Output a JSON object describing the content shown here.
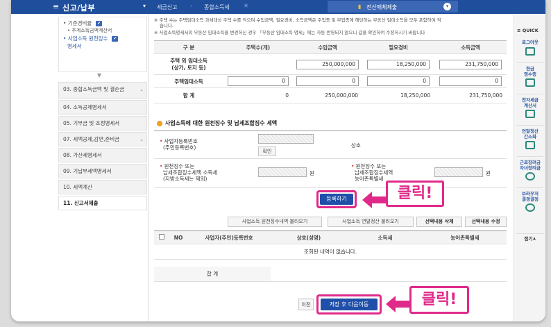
{
  "topbar": {
    "title": "신고/납부",
    "crumb1": "세금신고",
    "crumb2": "종합소득세",
    "esubmit": "전산매체제출"
  },
  "sidebar": {
    "sub": [
      {
        "label": "기준경비율"
      },
      {
        "label": "추계소득금액계산서"
      },
      {
        "label": "사업소득 원천징수"
      },
      {
        "label": "명세서"
      }
    ],
    "nav": [
      {
        "label": "03. 종합소득금액 및 결손금"
      },
      {
        "label": "04. 소득공제명세서"
      },
      {
        "label": "05. 기부금 및 조정명세서"
      },
      {
        "label": "07. 세액공제,감면,준비금"
      },
      {
        "label": "08. 가산세명세서"
      },
      {
        "label": "09. 기납부세액명세서"
      },
      {
        "label": "10. 세액계산"
      },
      {
        "label": "11. 신고서제출"
      }
    ]
  },
  "notes": {
    "line1": "※ 주택 수는 주택임대소득 과세대상 주택 수를 적으며 수입금액, 필요경비, 소득금액은 주업종 및 부업종에 해당하는 부동산 임대소득을 모두 포함하여 적",
    "line1b": "습니다.",
    "line2": "※ 사업소득명세서의 부동산 임대소득을 변경하신 경우 「부동산 임대소득 명세」에는 자동 반영되지 않으니 값을 확인하여 수정하시기 바랍니다"
  },
  "income_table": {
    "headers": [
      "구 분",
      "주택수(개)",
      "수입금액",
      "필요경비",
      "소득금액"
    ],
    "rows": [
      {
        "label": "주택 외 임대소득\n(상가, 토지 등)",
        "count": "",
        "revenue": "250,000,000",
        "expense": "18,250,000",
        "income": "231,750,000"
      },
      {
        "label": "주택임대소득",
        "count": "0",
        "revenue": "0",
        "expense": "0",
        "income": "0"
      },
      {
        "label": "합 계",
        "count": "0",
        "revenue": "250,000,000",
        "expense": "18,250,000",
        "income": "231,750,000"
      }
    ]
  },
  "withholding": {
    "section_title": "사업소득에 대한 원천징수 및 납세조합징수 세액",
    "biz_no_label_1": "사업자등록번호",
    "biz_no_label_2": "(주민등록번호)",
    "confirm_btn": "확인",
    "company_label": "상호",
    "tax_label_1": "원천징수 또는",
    "tax_label_2": "납세조합징수세액 소득세",
    "tax_label_3": "(지방소득세는 제외)",
    "won1": "원",
    "rural_label_1": "원천징수 또는",
    "rural_label_2": "납세조합징수세액",
    "rural_label_3": "농어촌특별세",
    "won2": "원",
    "register_btn": "등록하기"
  },
  "actions": {
    "load1": "사업소득 원천징수내역 불러오기",
    "load2": "사업소득 연말정산 불러오기",
    "delete": "선택내용 삭제",
    "edit": "선택내용 수정"
  },
  "result_table": {
    "headers": [
      "NO",
      "사업자(주민)등록번호",
      "상호(성명)",
      "소득세",
      "농어촌특별세"
    ],
    "empty": "조회된 내역이 없습니다.",
    "total": "합 계"
  },
  "footer": {
    "prev": "이전",
    "save_next": "저장 후 다음이동"
  },
  "callouts": {
    "click1": "클릭!",
    "click2": "클릭!"
  },
  "quick": {
    "title": "≡ QUICK",
    "items": [
      {
        "label": "로그아웃"
      },
      {
        "label": "현금\n영수증"
      },
      {
        "label": "전자세금\n계산서"
      },
      {
        "label": "연말정산\n간소화"
      },
      {
        "label": "근로장려금\n자녀장려금"
      },
      {
        "label": "브라우저\n결경결정"
      }
    ],
    "close": "접기∧"
  }
}
